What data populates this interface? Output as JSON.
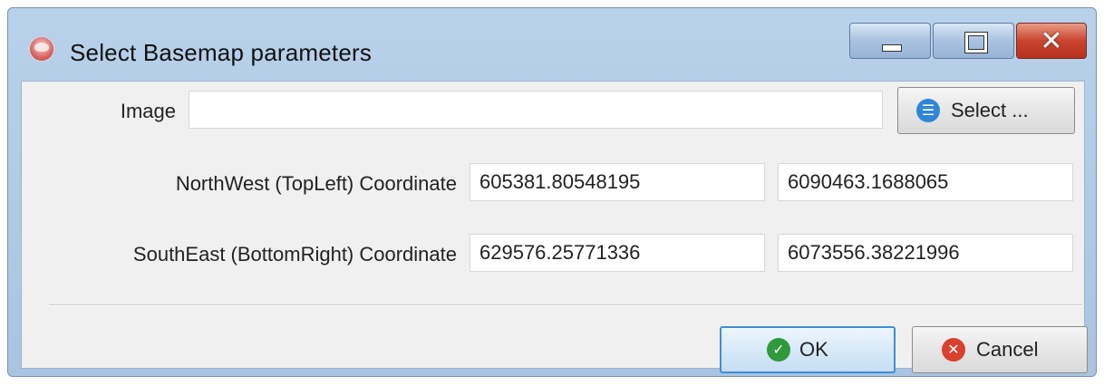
{
  "window": {
    "title": "Select Basemap parameters",
    "title_icon": "basemap-app-icon",
    "controls": {
      "minimize_icon": "minimize-icon",
      "maximize_icon": "maximize-icon",
      "close_icon": "close-icon",
      "close_glyph": "✕"
    }
  },
  "form": {
    "image": {
      "label": "Image",
      "value": ""
    },
    "select_button": {
      "label": "Select ...",
      "icon": "list-icon",
      "icon_glyph": "☰"
    },
    "northwest": {
      "label": "NorthWest (TopLeft) Coordinate",
      "x": "605381.80548195",
      "y": "6090463.1688065"
    },
    "southeast": {
      "label": "SouthEast (BottomRight) Coordinate",
      "x": "629576.25771336",
      "y": "6073556.38221996"
    }
  },
  "buttons": {
    "ok": {
      "label": "OK",
      "icon": "check-icon",
      "icon_glyph": "✓",
      "icon_color": "#2e9a3b"
    },
    "cancel": {
      "label": "Cancel",
      "icon": "cancel-icon",
      "icon_glyph": "✕",
      "icon_color": "#d9402f"
    }
  },
  "colors": {
    "title_bar": "#b9d1ea",
    "client_bg": "#f0f0f0",
    "close_button": "#c9452f",
    "select_icon": "#2f86d6",
    "ok_focus_border": "#3c8fd6"
  }
}
